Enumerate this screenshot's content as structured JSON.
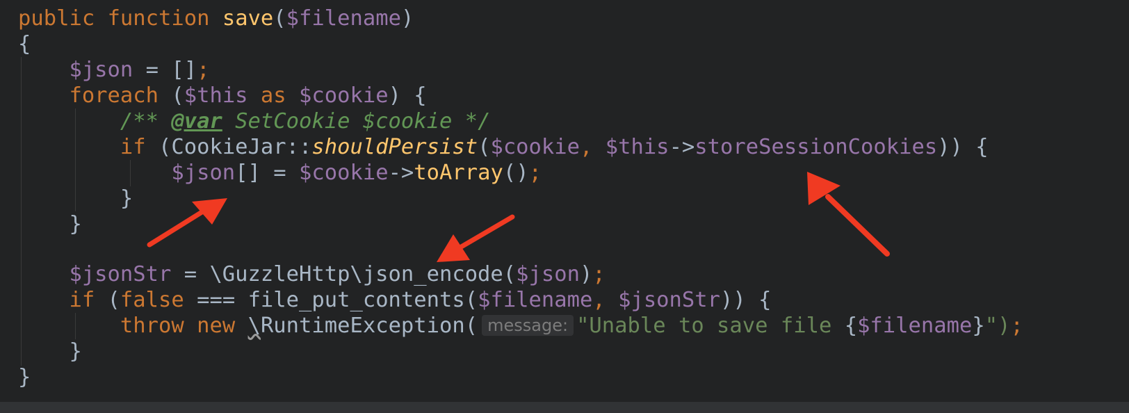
{
  "code": {
    "line1": {
      "kw_public": "public",
      "kw_function": "function",
      "fn_save": "save",
      "paren_open": "(",
      "param": "$filename",
      "paren_close": ")"
    },
    "line2": {
      "brace": "{"
    },
    "line3": {
      "var_json": "$json",
      "assign": " = []",
      "semi": ";"
    },
    "line4": {
      "kw_foreach": "foreach",
      "paren_open": " (",
      "var_this": "$this",
      "kw_as": " as ",
      "var_cookie": "$cookie",
      "rest": ") {"
    },
    "line5": {
      "cmt_start": "/** ",
      "tag_var": "@var",
      "cmt_end": " SetCookie $cookie */"
    },
    "line6": {
      "kw_if": "if",
      "class_call": " (CookieJar::",
      "static_method": "shouldPersist",
      "paren": "(",
      "var_cookie": "$cookie",
      "comma": ", ",
      "var_this": "$this",
      "arrow": "->",
      "prop": "storeSessionCookies",
      "rest": ")) {"
    },
    "line7": {
      "var_json": "$json",
      "mid": "[] = ",
      "var_cookie": "$cookie",
      "arrow": "->",
      "method": "toArray",
      "parens": "()",
      "semi": ";"
    },
    "line8": {
      "brace": "}"
    },
    "line9": {
      "brace": "}"
    },
    "line11": {
      "var_jsonstr": "$jsonStr",
      "mid": " = \\GuzzleHttp\\json_encode(",
      "var_json": "$json",
      "close": ")",
      "semi": ";"
    },
    "line12": {
      "kw_if": "if",
      "paren": " (",
      "kw_false": "false",
      "mid": " === file_put_contents(",
      "var_filename": "$filename",
      "comma": ", ",
      "var_jsonstr": "$jsonStr",
      "rest": ")) {"
    },
    "line13": {
      "kw_throw": "throw",
      "kw_new": " new ",
      "backslash": "\\",
      "class": "RuntimeException(",
      "hint": "message:",
      "str_open": "\"Unable to save file ",
      "brace_open": "{",
      "var_filename": "$filename",
      "brace_close": "}",
      "str_close": "\")",
      "semi": ";"
    },
    "line14": {
      "brace": "}"
    },
    "line15": {
      "brace": "}"
    }
  },
  "colors": {
    "background": "#222324",
    "keyword": "#cc7832",
    "function": "#ffc66d",
    "variable": "#9876aa",
    "text": "#a9b7c6",
    "comment": "#629755",
    "string": "#6a8759",
    "arrow": "#f03a22"
  }
}
